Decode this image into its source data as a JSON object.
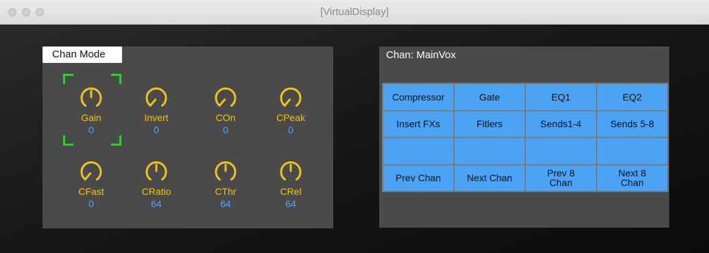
{
  "window": {
    "title": "[VirtualDisplay]"
  },
  "mode_panel": {
    "label": "Chan Mode",
    "knob_color": "#f0c419",
    "value_color": "#4aa8ff",
    "selection_color": "#3cc43c",
    "knobs": [
      {
        "name": "Gain",
        "value": "0"
      },
      {
        "name": "Invert",
        "value": "0"
      },
      {
        "name": "COn",
        "value": "0"
      },
      {
        "name": "CPeak",
        "value": "0"
      },
      {
        "name": "CFast",
        "value": "0"
      },
      {
        "name": "CRatio",
        "value": "64"
      },
      {
        "name": "CThr",
        "value": "64"
      },
      {
        "name": "CRel",
        "value": "64"
      }
    ],
    "selected_knob": "Gain"
  },
  "chan_panel": {
    "title": "Chan: MainVox",
    "button_color": "#4aa3f5",
    "buttons": [
      "Compressor",
      "Gate",
      "EQ1",
      "EQ2",
      "Insert FXs",
      "Fitlers",
      "Sends1-4",
      "Sends 5-8",
      "",
      "",
      "",
      "",
      "Prev Chan",
      "Next Chan",
      "Prev 8\nChan",
      "Next 8\nChan"
    ]
  }
}
